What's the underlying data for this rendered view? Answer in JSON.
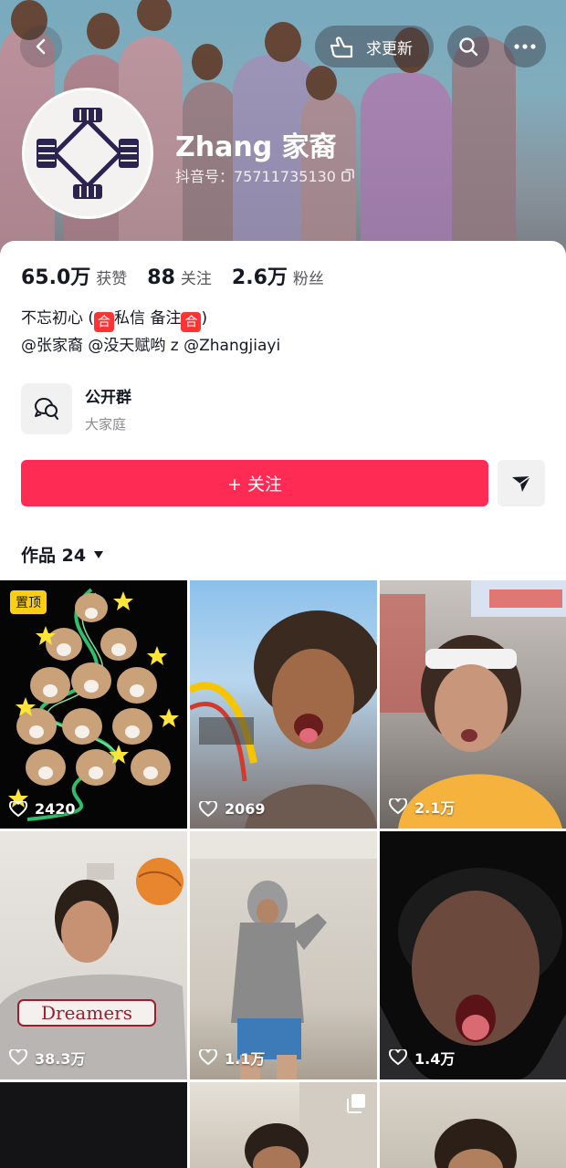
{
  "header": {
    "update_label": "求更新",
    "name": "Zhang 家裔",
    "douyin_id": "抖音号：75711735130"
  },
  "stats": [
    {
      "num": "65.0万",
      "label": "获赞"
    },
    {
      "num": "88",
      "label": "关注"
    },
    {
      "num": "2.6万",
      "label": "粉丝"
    }
  ],
  "bio": {
    "line1_a": "不忘初心 (",
    "emoji": "合",
    "line1_b": "私信 备注",
    "line1_c": ")",
    "line2": "@张家裔 @没天赋哟 z @Zhangjiayi"
  },
  "group": {
    "title": "公开群",
    "subtitle": "大家庭"
  },
  "follow_label": "+ 关注",
  "works": {
    "label": "作品 24"
  },
  "pinned_label": "置顶",
  "tiles": [
    {
      "likes": "2420"
    },
    {
      "likes": "2069"
    },
    {
      "likes": "2.1万"
    },
    {
      "likes": "38.3万"
    },
    {
      "likes": "1.1万"
    },
    {
      "likes": "1.4万"
    }
  ],
  "colors": {
    "accent": "#fe2c55",
    "pin": "#face15"
  }
}
